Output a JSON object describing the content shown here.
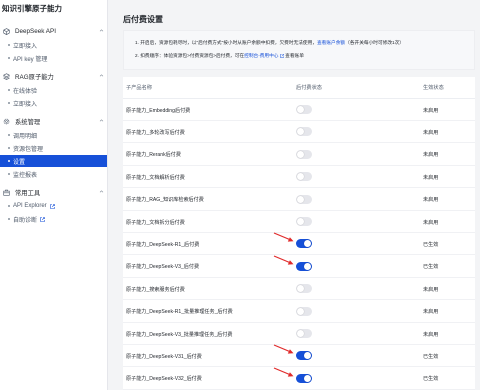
{
  "app": {
    "title": "知识引擎原子能力"
  },
  "colors": {
    "accent": "#1650d8",
    "arrow": "#e02a2a",
    "toggle_off": "#e5e6eb"
  },
  "sidebar": {
    "groups": [
      {
        "label": "DeepSeek API",
        "icon": "cube-icon",
        "items": [
          {
            "label": "立即接入",
            "active": false,
            "external": false
          },
          {
            "label": "API key 管理",
            "active": false,
            "external": false
          }
        ]
      },
      {
        "label": "RAG原子能力",
        "icon": "layers-icon",
        "items": [
          {
            "label": "在线体验",
            "active": false,
            "external": false
          },
          {
            "label": "立即接入",
            "active": false,
            "external": false
          }
        ]
      },
      {
        "label": "系统管理",
        "icon": "gear-icon",
        "items": [
          {
            "label": "调用明细",
            "active": false,
            "external": false
          },
          {
            "label": "资源包管理",
            "active": false,
            "external": false
          },
          {
            "label": "设置",
            "active": true,
            "external": false
          },
          {
            "label": "监控报表",
            "active": false,
            "external": false
          }
        ]
      },
      {
        "label": "常用工具",
        "icon": "toolbox-icon",
        "items": [
          {
            "label": "API Explorer",
            "active": false,
            "external": true
          },
          {
            "label": "自助诊断",
            "active": false,
            "external": true
          }
        ]
      }
    ]
  },
  "main": {
    "title": "后付费设置",
    "notice": {
      "line1_prefix": "1. 开启后，资源包耗尽时，以\"后付费方式\"按小时从账户余额中扣费，欠费时无法使用，",
      "line1_link": "查看账户余额",
      "line1_suffix": "（各开关每小时可修改1次）",
      "line2_prefix": "2. 扣费顺序：体验资源包>付费资源包>后付费，可在",
      "line2_link": "控制台-费用中心",
      "line2_suffix": "查看账单"
    },
    "table": {
      "headers": {
        "name": "子产品名称",
        "switch": "后付费状态",
        "status": "生效状态"
      },
      "rows": [
        {
          "name": "原子能力_Embedding后付费",
          "on": false,
          "status": "未启用",
          "arrow": false
        },
        {
          "name": "原子能力_多轮改写后付费",
          "on": false,
          "status": "未启用",
          "arrow": false
        },
        {
          "name": "原子能力_Rerank后付费",
          "on": false,
          "status": "未启用",
          "arrow": false
        },
        {
          "name": "原子能力_文档解析后付费",
          "on": false,
          "status": "未启用",
          "arrow": false
        },
        {
          "name": "原子能力_RAG_知识库检索后付费",
          "on": false,
          "status": "未启用",
          "arrow": false
        },
        {
          "name": "原子能力_文档拆分后付费",
          "on": false,
          "status": "未启用",
          "arrow": false
        },
        {
          "name": "原子能力_DeepSeek-R1_后付费",
          "on": true,
          "status": "已生效",
          "arrow": true
        },
        {
          "name": "原子能力_DeepSeek-V3_后付费",
          "on": true,
          "status": "已生效",
          "arrow": true
        },
        {
          "name": "原子能力_搜索服务后付费",
          "on": false,
          "status": "未启用",
          "arrow": false
        },
        {
          "name": "原子能力_DeepSeek-R1_批量推理任务_后付费",
          "on": false,
          "status": "未启用",
          "arrow": false
        },
        {
          "name": "原子能力_DeepSeek-V3_批量推理任务_后付费",
          "on": false,
          "status": "未启用",
          "arrow": false
        },
        {
          "name": "原子能力_DeepSeek-V31_后付费",
          "on": true,
          "status": "已生效",
          "arrow": true
        },
        {
          "name": "原子能力_DeepSeek-V32_后付费",
          "on": true,
          "status": "已生效",
          "arrow": true
        }
      ]
    }
  }
}
